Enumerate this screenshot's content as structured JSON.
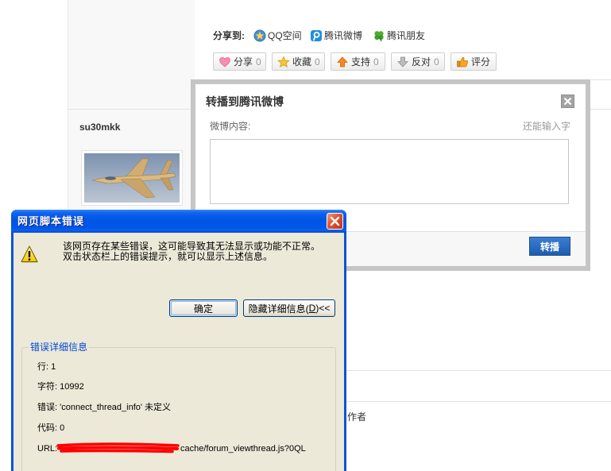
{
  "colors": {
    "page_background": "#ffffff",
    "sidebar_background": "#f8f8f8",
    "weibo_border": "#c5c5c5",
    "weibo_submit": "#1f5eae",
    "xp_title_blue": "#0054e3",
    "xp_face": "#ece9d8",
    "xp_group_label": "#0046d5",
    "redaction": "#ff0000"
  },
  "share": {
    "label": "分享到:",
    "targets": [
      {
        "label": "QQ空间",
        "icon": "qzone-icon"
      },
      {
        "label": "腾讯微博",
        "icon": "tencent-weibo-icon"
      },
      {
        "label": "腾讯朋友",
        "icon": "tencent-friends-icon"
      }
    ]
  },
  "actions": [
    {
      "label": "分享",
      "count": "0",
      "icon": "heart-icon"
    },
    {
      "label": "收藏",
      "count": "0",
      "icon": "star-icon"
    },
    {
      "label": "支持",
      "count": "0",
      "icon": "arrow-up-icon"
    },
    {
      "label": "反对",
      "count": "0",
      "icon": "arrow-down-icon"
    },
    {
      "label": "评分",
      "icon": "thumbs-up-icon"
    }
  ],
  "post": {
    "author": "su30mkk"
  },
  "weibo_dialog": {
    "title": "转播到腾讯微博",
    "close_icon": "close-icon",
    "content_label": "微博内容:",
    "remaining_label": "还能输入字",
    "content_value": "",
    "submit_label": "转播"
  },
  "error_dialog": {
    "title": "网页脚本错误",
    "icon": "warning-icon",
    "message": [
      "该网页存在某些错误，这可能导致其无法显示或功能不正常。",
      "双击状态栏上的错误提示，就可以显示上述信息。"
    ],
    "ok_label": "确定",
    "details_button": {
      "text_before": "隐藏详细信息(",
      "access_key": "D",
      "text_after": ")<<"
    },
    "details_title": "错误详细信息",
    "details": {
      "line": "行: 1",
      "char": "字符: 10992",
      "error": "错误: 'connect_thread_info' 未定义",
      "code": "代码: 0",
      "url_label": "URL:",
      "url_visible": "cache/forum_viewthread.js?0QL"
    }
  },
  "background": {
    "author_label": "作者"
  }
}
